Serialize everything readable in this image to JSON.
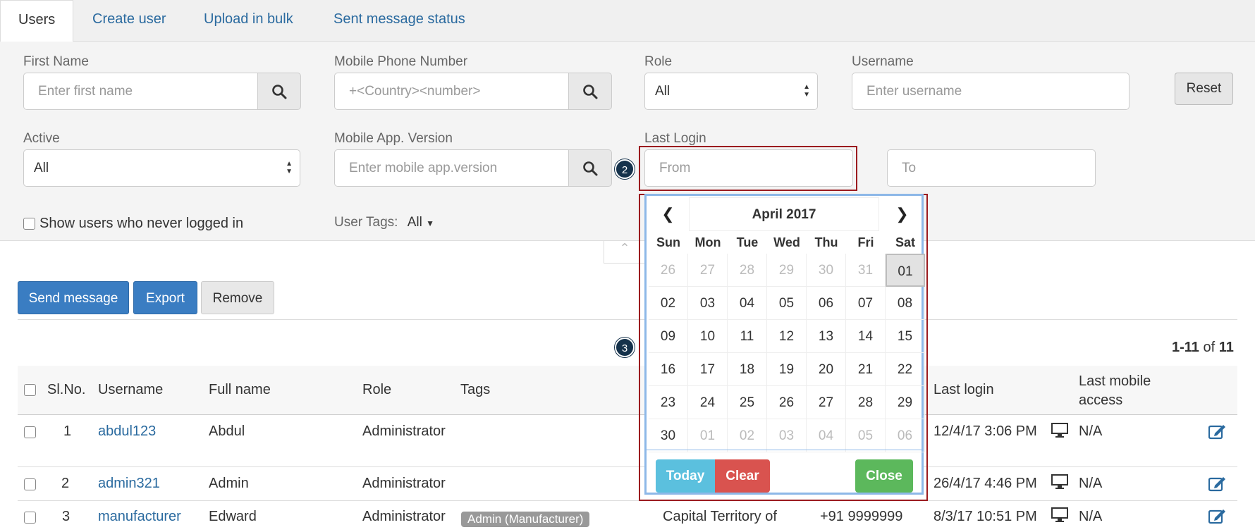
{
  "tabs": [
    {
      "label": "Users"
    },
    {
      "label": "Create user"
    },
    {
      "label": "Upload in bulk"
    },
    {
      "label": "Sent message status"
    }
  ],
  "filters": {
    "first_name": {
      "label": "First Name",
      "placeholder": "Enter first name"
    },
    "mobile": {
      "label": "Mobile Phone Number",
      "placeholder": "+<Country><number>"
    },
    "role": {
      "label": "Role",
      "value": "All"
    },
    "username": {
      "label": "Username",
      "placeholder": "Enter username"
    },
    "reset_label": "Reset",
    "active": {
      "label": "Active",
      "value": "All"
    },
    "app_version": {
      "label": "Mobile App. Version",
      "placeholder": "Enter mobile app.version"
    },
    "last_login": {
      "label": "Last Login",
      "from_placeholder": "From",
      "to_placeholder": "To"
    },
    "never_logged_in_label": "Show users who never logged in",
    "user_tags": {
      "label": "User Tags:",
      "value": "All"
    }
  },
  "markers": {
    "m2": "2",
    "m3": "3"
  },
  "actions": {
    "send": "Send message",
    "export": "Export",
    "remove": "Remove"
  },
  "pagination": {
    "range": "1-11",
    "of": "of",
    "total": "11"
  },
  "table": {
    "headers": {
      "slno": "Sl.No.",
      "username": "Username",
      "fullname": "Full name",
      "role": "Role",
      "tags": "Tags",
      "last_login": "Last login",
      "last_mobile_1": "Last mobile",
      "last_mobile_2": "access"
    },
    "rows": [
      {
        "slno": "1",
        "username": "abdul123",
        "fullname": "Abdul",
        "role": "Administrator",
        "tag": "",
        "location": "",
        "phone": "",
        "last_login": "12/4/17 3:06 PM",
        "mobile_access": "N/A"
      },
      {
        "slno": "2",
        "username": "admin321",
        "fullname": "Admin",
        "role": "Administrator",
        "tag": "",
        "location": "",
        "phone": "",
        "last_login": "26/4/17 4:46 PM",
        "mobile_access": "N/A"
      },
      {
        "slno": "3",
        "username": "manufacturer",
        "fullname": "Edward",
        "role": "Administrator",
        "tag": "Admin (Manufacturer)",
        "location": "Capital Territory of",
        "phone": "+91 9999999",
        "last_login": "8/3/17 10:51 PM",
        "mobile_access": "N/A"
      }
    ]
  },
  "datepicker": {
    "month": "April 2017",
    "prev_glyph": "❮",
    "next_glyph": "❯",
    "dow": [
      "Sun",
      "Mon",
      "Tue",
      "Wed",
      "Thu",
      "Fri",
      "Sat"
    ],
    "weeks": [
      [
        {
          "d": "26",
          "m": true
        },
        {
          "d": "27",
          "m": true
        },
        {
          "d": "28",
          "m": true
        },
        {
          "d": "29",
          "m": true
        },
        {
          "d": "30",
          "m": true
        },
        {
          "d": "31",
          "m": true
        },
        {
          "d": "01",
          "sel": true
        }
      ],
      [
        {
          "d": "02"
        },
        {
          "d": "03"
        },
        {
          "d": "04"
        },
        {
          "d": "05"
        },
        {
          "d": "06"
        },
        {
          "d": "07"
        },
        {
          "d": "08"
        }
      ],
      [
        {
          "d": "09"
        },
        {
          "d": "10"
        },
        {
          "d": "11"
        },
        {
          "d": "12"
        },
        {
          "d": "13"
        },
        {
          "d": "14"
        },
        {
          "d": "15"
        }
      ],
      [
        {
          "d": "16"
        },
        {
          "d": "17"
        },
        {
          "d": "18"
        },
        {
          "d": "19"
        },
        {
          "d": "20"
        },
        {
          "d": "21"
        },
        {
          "d": "22"
        }
      ],
      [
        {
          "d": "23"
        },
        {
          "d": "24"
        },
        {
          "d": "25"
        },
        {
          "d": "26"
        },
        {
          "d": "27"
        },
        {
          "d": "28"
        },
        {
          "d": "29"
        }
      ],
      [
        {
          "d": "30"
        },
        {
          "d": "01",
          "m": true
        },
        {
          "d": "02",
          "m": true
        },
        {
          "d": "03",
          "m": true
        },
        {
          "d": "04",
          "m": true
        },
        {
          "d": "05",
          "m": true
        },
        {
          "d": "06",
          "m": true
        }
      ]
    ],
    "today_label": "Today",
    "clear_label": "Clear",
    "close_label": "Close"
  },
  "colors": {
    "primary": "#3a7dc2",
    "link": "#2a6a9f",
    "today": "#5bc0de",
    "clear": "#d9534f",
    "close": "#5cb85c",
    "highlight": "#9b1b1f"
  }
}
